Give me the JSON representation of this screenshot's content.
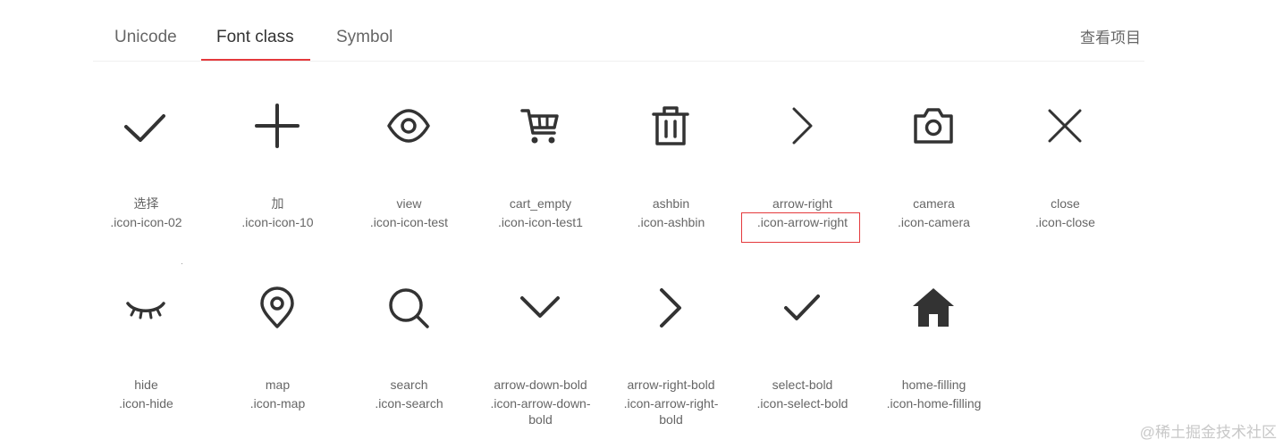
{
  "tabs": [
    {
      "label": "Unicode"
    },
    {
      "label": "Font class"
    },
    {
      "label": "Symbol"
    }
  ],
  "active_tab": "Font class",
  "view_project_label": "查看项目",
  "accent_color": "#e4393c",
  "icons": [
    {
      "icon": "check-icon",
      "name": "选择",
      "code": ".icon-icon-02"
    },
    {
      "icon": "plus-icon",
      "name": "加",
      "code": ".icon-icon-10"
    },
    {
      "icon": "eye-icon",
      "name": "view",
      "code": ".icon-icon-test"
    },
    {
      "icon": "cart-icon",
      "name": "cart_empty",
      "code": ".icon-icon-test1"
    },
    {
      "icon": "trash-icon",
      "name": "ashbin",
      "code": ".icon-ashbin"
    },
    {
      "icon": "chevron-right-icon",
      "name": "arrow-right",
      "code": ".icon-arrow-right"
    },
    {
      "icon": "camera-icon",
      "name": "camera",
      "code": ".icon-camera"
    },
    {
      "icon": "close-icon",
      "name": "close",
      "code": ".icon-close"
    },
    {
      "icon": "eye-closed-icon",
      "name": "hide",
      "code": ".icon-hide"
    },
    {
      "icon": "map-pin-icon",
      "name": "map",
      "code": ".icon-map"
    },
    {
      "icon": "search-icon",
      "name": "search",
      "code": ".icon-search"
    },
    {
      "icon": "chevron-down-bold-icon",
      "name": "arrow-down-bold",
      "code": ".icon-arrow-down-bold"
    },
    {
      "icon": "chevron-right-bold-icon",
      "name": "arrow-right-bold",
      "code": ".icon-arrow-right-bold"
    },
    {
      "icon": "check-bold-icon",
      "name": "select-bold",
      "code": ".icon-select-bold"
    },
    {
      "icon": "home-filled-icon",
      "name": "home-filling",
      "code": ".icon-home-filling"
    }
  ],
  "watermark": "@稀土掘金技术社区"
}
